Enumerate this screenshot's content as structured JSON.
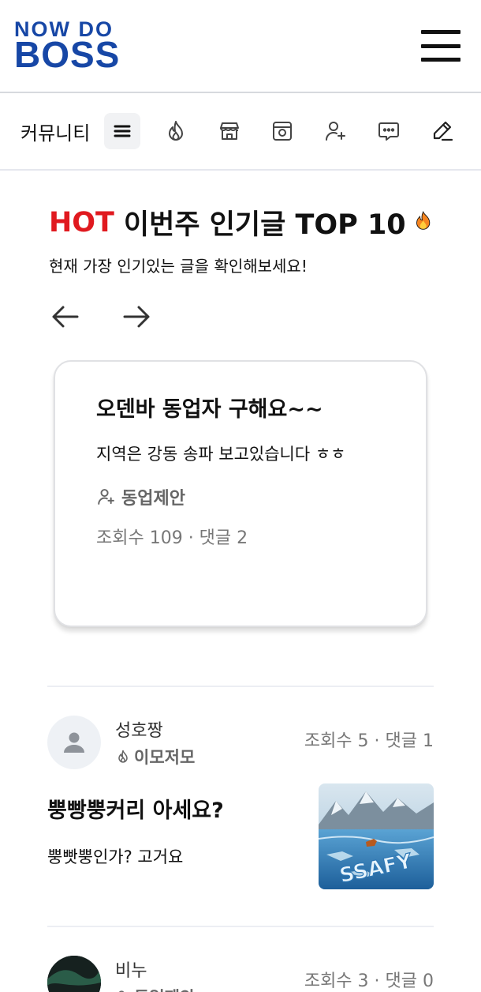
{
  "header": {
    "logo_line1": "NOW DO",
    "logo_line2": "BOSS"
  },
  "category_nav": {
    "title": "커뮤니티",
    "icons": [
      "list-icon",
      "fire-icon",
      "store-icon",
      "shop-map-icon",
      "user-plus-icon",
      "chat-bubble-icon",
      "pencil-icon"
    ]
  },
  "hot": {
    "hot_word": "HOT",
    "title_rest": "이번주 인기글 TOP 10",
    "subtitle": "현재 가장 인기있는 글을 확인해보세요!"
  },
  "featured": {
    "title": "오덴바 동업자 구해요~~",
    "body": "지역은 강동 송파 보고있습니다 ㅎㅎ",
    "category": "동업제안",
    "meta": "조회수 109 · 댓글 2"
  },
  "posts": [
    {
      "author": "성호짱",
      "category": "이모저모",
      "stats": "조회수 5 · 댓글 1",
      "title": "뿡빵뿡커리 아세요?",
      "text": "뿡빳뿡인가? 고거요",
      "thumbnail_text": "SSAFY"
    },
    {
      "author": "비누",
      "category": "동업제안",
      "stats": "조회수 3 · 댓글 0"
    }
  ],
  "colors": {
    "brand": "#1747a6",
    "hot": "#e0191f"
  }
}
